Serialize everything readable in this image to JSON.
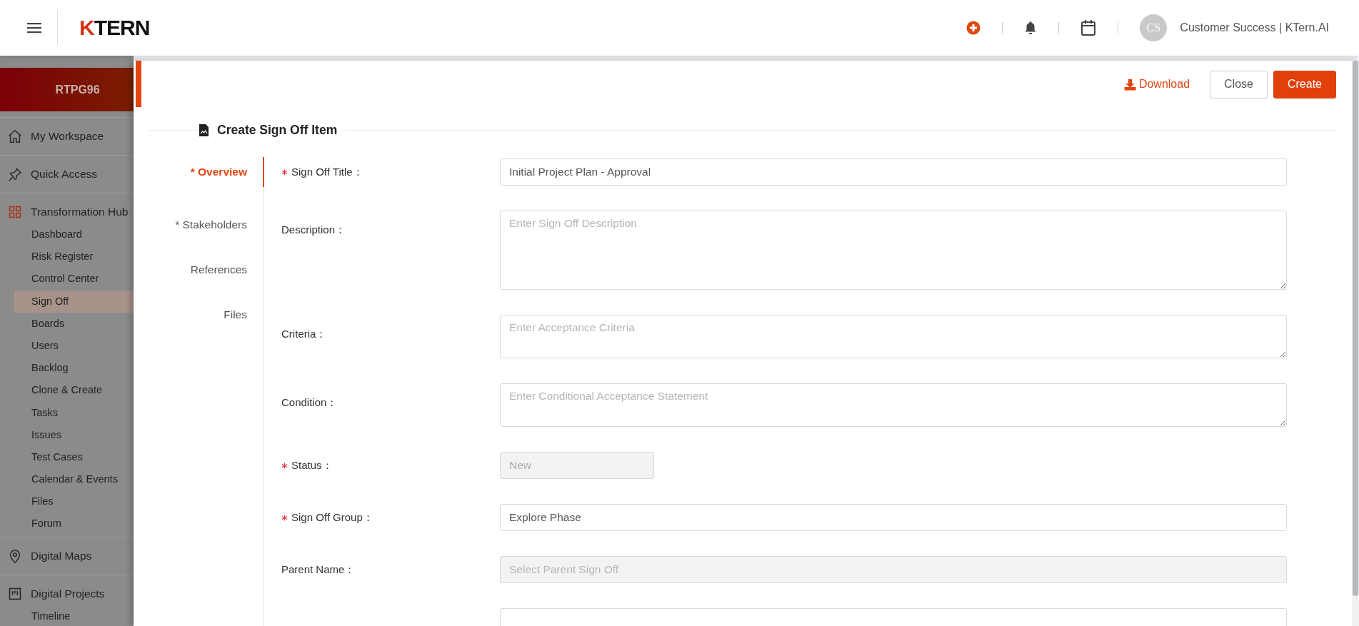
{
  "header": {
    "logo": "KTERN",
    "user": {
      "initials": "CS",
      "name": "Customer Success | KTern.AI"
    }
  },
  "sidebar": {
    "project": "RTPG96",
    "sections": [
      {
        "label": "My Workspace",
        "kind": "home",
        "selected": false
      },
      {
        "label": "Quick Access",
        "kind": "pin",
        "selected": false
      },
      {
        "label": "Transformation Hub",
        "kind": "grid",
        "selected": true,
        "children": [
          {
            "label": "Dashboard",
            "selected": false
          },
          {
            "label": "Risk Register",
            "selected": false
          },
          {
            "label": "Control Center",
            "selected": false
          },
          {
            "label": "Sign Off",
            "selected": true
          },
          {
            "label": "Boards",
            "selected": false
          },
          {
            "label": "Users",
            "selected": false
          },
          {
            "label": "Backlog",
            "selected": false
          },
          {
            "label": "Clone & Create",
            "selected": false
          },
          {
            "label": "Tasks",
            "selected": false
          },
          {
            "label": "Issues",
            "selected": false
          },
          {
            "label": "Test Cases",
            "selected": false
          },
          {
            "label": "Calendar & Events",
            "selected": false
          },
          {
            "label": "Files",
            "selected": false
          },
          {
            "label": "Forum",
            "selected": false
          }
        ]
      },
      {
        "label": "Digital Maps",
        "kind": "map",
        "selected": false
      },
      {
        "label": "Digital Projects",
        "kind": "board",
        "selected": false,
        "children": [
          {
            "label": "Timeline",
            "selected": false
          }
        ]
      }
    ]
  },
  "drawer": {
    "download": "Download",
    "buttons": [
      {
        "label": "Close",
        "kind": "secondary"
      },
      {
        "label": "Create",
        "kind": "primary"
      }
    ],
    "title": "Create Sign Off Item",
    "tabs": [
      {
        "label": "* Overview",
        "selected": true
      },
      {
        "label": "* Stakeholders",
        "selected": false
      },
      {
        "label": "References",
        "selected": false
      },
      {
        "label": "Files",
        "selected": false
      }
    ],
    "fields": [
      {
        "label": "Sign Off Title：",
        "kind": "input",
        "required": true,
        "disabled": false,
        "value": "Initial Project Plan - Approval"
      },
      {
        "label": "Description：",
        "kind": "textarea-large",
        "required": false,
        "disabled": false,
        "placeholder": "Enter Sign Off Description"
      },
      {
        "label": "Criteria：",
        "kind": "textarea",
        "required": false,
        "disabled": false,
        "placeholder": "Enter Acceptance Criteria"
      },
      {
        "label": "Condition：",
        "kind": "textarea",
        "required": false,
        "disabled": false,
        "placeholder": "Enter Conditional Acceptance Statement"
      },
      {
        "label": "Status：",
        "kind": "short-input",
        "required": true,
        "disabled": true,
        "value": "New"
      },
      {
        "label": "Sign Off Group：",
        "kind": "input",
        "required": true,
        "disabled": false,
        "value": "Explore Phase"
      },
      {
        "label": "Parent Name：",
        "kind": "input",
        "required": false,
        "disabled": true,
        "placeholder": "Select Parent Sign Off"
      },
      {
        "kind": "input",
        "required": false,
        "disabled": false
      }
    ]
  }
}
